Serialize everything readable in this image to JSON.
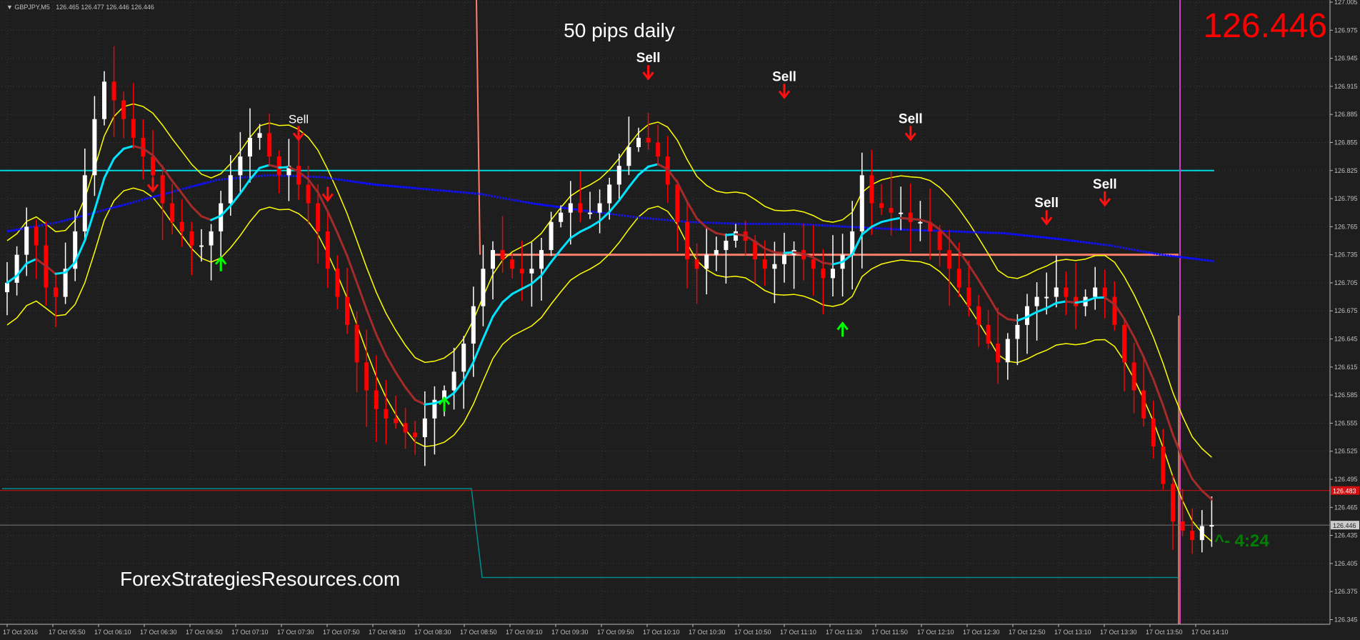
{
  "window": {
    "symbol_info": "GBPJPY,M5",
    "ohlc": "126.465 126.477 126.446 126.446"
  },
  "overlay": {
    "title": "50 pips daily",
    "price": "126.446",
    "watermark": "ForexStrategiesResources.com",
    "timer": "^- 4:24",
    "price_tag": "126.483",
    "bid_tag": "126.446"
  },
  "signals": [
    {
      "type": "sell",
      "label": "Sell",
      "time_index": 66,
      "price": 126.93
    },
    {
      "type": "sell",
      "label": "",
      "time_index": 33,
      "price": 126.8
    },
    {
      "type": "sell",
      "label": "Sell",
      "time_index": 30,
      "price": 126.865,
      "style": "normal"
    },
    {
      "type": "sell",
      "label": "",
      "time_index": 15,
      "price": 126.81
    },
    {
      "type": "sell",
      "label": "Sell",
      "time_index": 80,
      "price": 126.91
    },
    {
      "type": "sell",
      "label": "Sell",
      "time_index": 93,
      "price": 126.865
    },
    {
      "type": "sell",
      "label": "Sell",
      "time_index": 107,
      "price": 126.775
    },
    {
      "type": "sell",
      "label": "Sell",
      "time_index": 113,
      "price": 126.795
    },
    {
      "type": "buy",
      "label": "",
      "time_index": 22,
      "price": 126.725
    },
    {
      "type": "buy",
      "label": "",
      "time_index": 45,
      "price": 126.575
    },
    {
      "type": "buy",
      "label": "",
      "time_index": 86,
      "price": 126.655
    }
  ],
  "colors": {
    "background": "#1e1e1e",
    "grid": "#3a3a3a",
    "bull": "#ffffff",
    "bear": "#ff0000",
    "band": "#ffff00",
    "ma_fast_up": "#00e5ff",
    "ma_fast_down": "#a52a2a",
    "ma_slow": "#1010ff",
    "level_cyan": "#00d8e0",
    "level_salmon": "#ff7f6a",
    "magenta_line": "#d040c0",
    "price_line": "#c01010",
    "teal_line": "#008c8c",
    "axis_text": "#c0c0c0"
  },
  "chart_data": {
    "type": "candlestick",
    "symbol": "GBPJPY",
    "timeframe": "M5",
    "y_ticks": [
      "127.005",
      "126.975",
      "126.945",
      "126.915",
      "126.885",
      "126.855",
      "126.825",
      "126.795",
      "126.765",
      "126.735",
      "126.705",
      "126.675",
      "126.645",
      "126.615",
      "126.585",
      "126.555",
      "126.525",
      "126.495",
      "126.465",
      "126.435",
      "126.405",
      "126.375",
      "126.345"
    ],
    "ylim": [
      126.34,
      127.005
    ],
    "x_ticks": [
      "17 Oct 2016",
      "17 Oct 05:50",
      "17 Oct 06:10",
      "17 Oct 06:30",
      "17 Oct 06:50",
      "17 Oct 07:10",
      "17 Oct 07:30",
      "17 Oct 07:50",
      "17 Oct 08:10",
      "17 Oct 08:30",
      "17 Oct 08:50",
      "17 Oct 09:10",
      "17 Oct 09:30",
      "17 Oct 09:50",
      "17 Oct 10:10",
      "17 Oct 10:30",
      "17 Oct 10:50",
      "17 Oct 11:10",
      "17 Oct 11:30",
      "17 Oct 11:50",
      "17 Oct 12:10",
      "17 Oct 12:30",
      "17 Oct 12:50",
      "17 Oct 13:10",
      "17 Oct 13:30",
      "17 Oct 13:50",
      "17 Oct 14:10"
    ],
    "closes": [
      126.705,
      126.735,
      126.765,
      126.745,
      126.7,
      126.69,
      126.72,
      126.76,
      126.82,
      126.88,
      126.92,
      126.9,
      126.88,
      126.86,
      126.84,
      126.82,
      126.79,
      126.77,
      126.76,
      126.745,
      126.745,
      126.76,
      126.79,
      126.82,
      126.84,
      126.86,
      126.865,
      126.84,
      126.82,
      126.83,
      126.81,
      126.79,
      126.76,
      126.72,
      126.69,
      126.66,
      126.62,
      126.59,
      126.57,
      126.56,
      126.555,
      126.545,
      126.54,
      126.56,
      126.58,
      126.59,
      126.61,
      126.64,
      126.68,
      126.72,
      126.74,
      126.73,
      126.72,
      126.715,
      126.72,
      126.74,
      126.77,
      126.78,
      126.79,
      126.78,
      126.78,
      126.79,
      126.81,
      126.83,
      126.85,
      126.86,
      126.855,
      126.84,
      126.81,
      126.77,
      126.73,
      126.72,
      126.735,
      126.74,
      126.75,
      126.76,
      126.75,
      126.73,
      126.72,
      126.725,
      126.735,
      126.74,
      126.73,
      126.72,
      126.71,
      126.72,
      126.735,
      126.76,
      126.82,
      126.79,
      126.785,
      126.78,
      126.78,
      126.77,
      126.77,
      126.76,
      126.74,
      126.72,
      126.7,
      126.68,
      126.66,
      126.64,
      126.62,
      126.645,
      126.66,
      126.68,
      126.69,
      126.69,
      126.7,
      126.69,
      126.68,
      126.69,
      126.7,
      126.69,
      126.66,
      126.62,
      126.59,
      126.56,
      126.53,
      126.49,
      126.45,
      126.44,
      126.43,
      126.445,
      126.446
    ],
    "levels": [
      {
        "name": "cyan-level",
        "price": 126.825
      },
      {
        "name": "salmon-level",
        "price": 126.735
      },
      {
        "name": "current-price",
        "price": 126.483
      },
      {
        "name": "bid-price",
        "price": 126.446
      }
    ],
    "series": [
      {
        "type": "sma",
        "values": [
          126.76,
          126.77,
          126.785,
          126.8,
          126.815,
          126.82,
          126.818,
          126.81,
          126.805,
          126.8,
          126.79,
          126.782,
          126.775,
          126.77,
          126.768,
          126.768,
          126.765,
          126.762,
          126.76,
          126.758,
          126.752,
          126.745,
          126.735,
          126.728
        ]
      }
    ]
  }
}
